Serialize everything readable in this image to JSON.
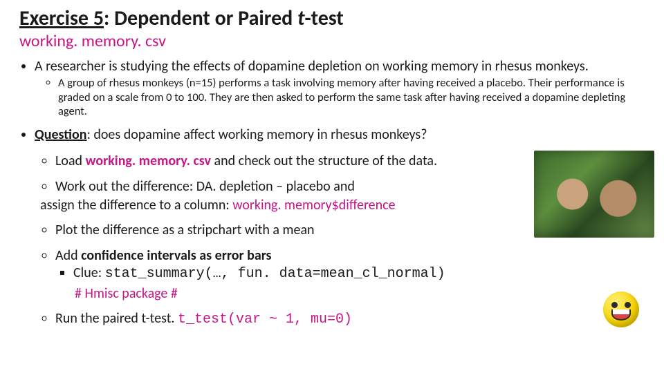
{
  "title": {
    "exercise_prefix": "Exercise 5",
    "continuation": ": Dependent or Paired ",
    "italic_t": "t",
    "suffix": "-test"
  },
  "subtitle": {
    "prefix": "",
    "filename": "working. memory. csv"
  },
  "intro_bullet": "A researcher is studying the effects of dopamine depletion on working memory in rhesus monkeys.",
  "intro_sub": "A group of rhesus monkeys (n=15) performs a task involving memory after having received a placebo. Their performance is graded on a scale from 0 to 100. They are then asked to perform the same task after having received a dopamine depleting agent.",
  "question": {
    "label": "Question",
    "text": ": does dopamine affect working memory in rhesus monkeys?"
  },
  "steps": {
    "load_a": "Load ",
    "load_file": "working. memory. csv",
    "load_b": " and check out the structure of the data.",
    "diff_a": "Work out the difference: DA. depletion – placebo and",
    "diff_b": "assign the difference to a column: ",
    "diff_col": "working. memory$difference",
    "plot": "Plot the difference as a stripchart with a mean",
    "ci_a": "Add ",
    "ci_bold": "confidence intervals as error bars",
    "ci_clue_label": "Clue: ",
    "ci_clue_code": "stat_summary(…,  fun. data=mean_cl_normal)",
    "ci_hmisc": "# Hmisc package #",
    "run_a": "Run the paired ",
    "run_t": "t",
    "run_b": "-test. ",
    "run_code": "t_test(var ~ 1, mu=0)"
  },
  "images": {
    "monkeys": "rhesus-monkeys-photo",
    "emoji": "grimace-emoji"
  }
}
